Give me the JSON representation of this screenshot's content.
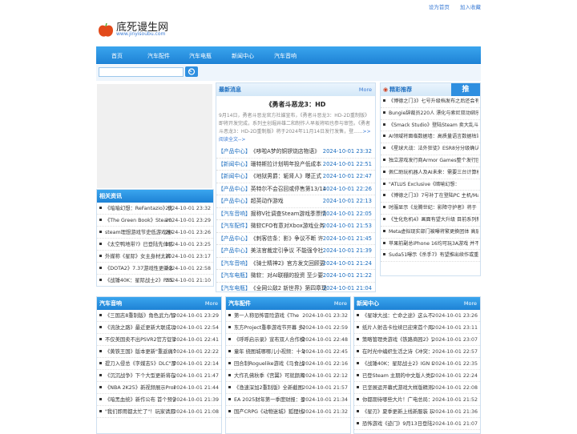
{
  "topbar": {
    "home": "设为首页",
    "fav": "加入收藏"
  },
  "logo": {
    "name": "底死谩生网",
    "url": "www.jinyisoubu.com"
  },
  "nav": [
    "首页",
    "汽车配件",
    "汽车电瓶",
    "新闻中心",
    "汽车音响"
  ],
  "colors": {
    "accent": "#1e82d5",
    "link": "#3a7bd5"
  },
  "latest": {
    "title": "最新消息",
    "more": "More",
    "headline": "《勇者斗恶龙3：HD",
    "summary": "9月14日，勇者斗恶龙官方社媒宣布，《勇者斗恶龙3：HD-2D重制版》即将开发完成，系列主创堀井雄二和制作人早坂将昭也参与审签。《勇者斗恶龙3：HD-2D重制版》将于2024年11月14日发行发售，登......",
    "read": ">>阅读全文-->",
    "items": [
      {
        "cat": "【产品中心】",
        "title": "《哆啦A梦的铜锣烧店物语》",
        "date": "2024-10-01 23:32"
      },
      {
        "cat": "【新闻中心】",
        "title": "珊特斯拉计划明年投产低成本",
        "date": "2024-10-01 22:51"
      },
      {
        "cat": "【新闻中心】",
        "title": "《地狱男爵：轭肾人》曝正式",
        "date": "2024-10-01 22:47"
      },
      {
        "cat": "【产品中心】",
        "title": "英特尔不会召回或停售第13/14",
        "date": "2024-10-01 22:26"
      },
      {
        "cat": "【产品中心】",
        "title": "超英动作游戏",
        "date": "2024-10-01 22:13"
      },
      {
        "cat": "【汽车音响】",
        "title": "掘称V社调查Steam游戏季票情",
        "date": "2024-10-01 22:05"
      },
      {
        "cat": "【汽车配件】",
        "title": "微软CFO有意对Xbox游戏业务",
        "date": "2024-10-01 21:53"
      },
      {
        "cat": "【产品中心】",
        "title": "《刺客信条：影》争议不断 许",
        "date": "2024-10-01 21:45"
      },
      {
        "cat": "【产品中心】",
        "title": "美法官裁定引争议 不能强令社",
        "date": "2024-10-01 21:39"
      },
      {
        "cat": "【汽车音响】",
        "title": "《骑士精神2》官方发文回顾更",
        "date": "2024-10-01 21:24"
      },
      {
        "cat": "【汽车电瓶】",
        "title": "微软：对AI联棚的投资 至少要",
        "date": "2024-10-01 21:22"
      },
      {
        "cat": "【汽车电瓶】",
        "title": "《全网公敌2 新世界》第四章现",
        "date": "2024-10-01 21:04"
      }
    ]
  },
  "recommend": {
    "title": "精彩推荐",
    "badge": "推",
    "items": [
      "《博德之门3》七号升级档发布之后还会有",
      "Bungie辞裁员220人 漂化与索尼双动绑乐",
      "《Smack Studio》登陆Steam 卖大乱斗风",
      "AI领域将面临数据墙：高质量语言数据枯竭",
      "《星球大战：法外狂徒》ESR8分分级确认包",
      "独立游戏发行商Armor Games整个发行团队",
      "佩仁助玩机器人及AI未来：需要三台计算机",
      "\"ATLUS Exclusive《暗喻幻想：",
      "《博德之门3》7号补丁在登陆PC 主机/Mac",
      "时服显示《龙腾世纪：影障守护者》将于",
      "《生化危机4》画面有望大升级 目前系列新",
      "Meta虚拟现实部门被曝将繁更换团体 高层",
      "苹果前副总iPhone 16均可玩3A游戏 并不",
      "Suda51曝示《杀手7》有望推出续作或重"
    ]
  },
  "related": {
    "title": "相关资讯",
    "items": [
      {
        "title": "《暗喻幻想：ReFantazio》优化",
        "date": "2024-10-01 23:32"
      },
      {
        "title": "《The Green Book》Steam页面",
        "date": "2024-10-01 23:29"
      },
      {
        "title": "steam理想游戏节史低游戏推荐",
        "date": "2024-10-01 23:26"
      },
      {
        "title": "《太空鸭地带?》已登陆先体验",
        "date": "2024-10-01 23:25"
      },
      {
        "title": "外媒称《星际》女主身材太裤",
        "date": "2024-10-01 23:17"
      },
      {
        "title": "《DOTA2》7.37游戏性更新发布",
        "date": "2024-10-01 22:58"
      },
      {
        "title": "《战锤40K：星际战士2》PS5宣",
        "date": "2024-10-01 21:10"
      }
    ]
  },
  "panels": [
    {
      "title": "汽车音响",
      "more": "More",
      "items": [
        {
          "title": "《三国志8重制版》角色武力/智力排",
          "date": "2024-10-01 23:29"
        },
        {
          "title": "《流放之路》最近更新大联成功",
          "date": "2024-10-01 22:54"
        },
        {
          "title": "不仅美国卖不出PSVR2官方促销",
          "date": "2024-10-01 22:41"
        },
        {
          "title": "《黄铁王国》版本更新\"重返痛气\"现",
          "date": "2024-10-01 22:22"
        },
        {
          "title": "提刀入侵总《字媒志5》DLC\"那马如",
          "date": "2024-10-01 22:14"
        },
        {
          "title": "《沉沉战争》下个大型更新将在2024",
          "date": "2024-10-01 21:47"
        },
        {
          "title": "《NBA 2K25》新视频展示ProPLAY",
          "date": "2024-10-01 21:44"
        },
        {
          "title": "《暗黑血统》新作公布 首个预告片",
          "date": "2024-10-01 21:39"
        },
        {
          "title": "\"我们即用都太忙了\"！玩家请愿重新",
          "date": "2024-10-01 21:08"
        }
      ]
    },
    {
      "title": "汽车配件",
      "more": "More",
      "items": [
        {
          "title": "第一人称恐怖冒险游戏《The",
          "date": "2024-10-01 23:32"
        },
        {
          "title": "东方Project重拳游戏节开幕 多款新",
          "date": "2024-10-01 22:59"
        },
        {
          "title": "《呼呼启示录》宣布双人合作模式将",
          "date": "2024-10-01 22:48"
        },
        {
          "title": "童年 绕图城哪哪儿小视频：十年后搞",
          "date": "2024-10-01 22:45"
        },
        {
          "title": "回合制Roguelike游戏《马食战藏》",
          "date": "2024-10-01 22:16"
        },
        {
          "title": "大作孔佛秋季《宫翼》可就颜离",
          "date": "2024-10-01 22:12"
        },
        {
          "title": "《渔速深加2重制版》全新截图 游戏",
          "date": "2024-10-01 21:57"
        },
        {
          "title": "EA 2025财年第一季度财报：盈利高",
          "date": "2024-10-01 21:34"
        },
        {
          "title": "国产CRPG《动物迷城》狐狸线已完",
          "date": "2024-10-01 21:32"
        }
      ]
    },
    {
      "title": "新闻中心",
      "more": "More",
      "items": [
        {
          "title": "《星球大战：亡命之途》这么不待",
          "date": "2024-10-01 23:26"
        },
        {
          "title": "纸片人射击卡拉续已迎来首个周年",
          "date": "2024-10-01 23:11"
        },
        {
          "title": "策略管理类游戏《铁路商园2》诞生",
          "date": "2024-10-01 23:07"
        },
        {
          "title": "在时光中编织生活之诗《冲突：前序",
          "date": "2024-10-01 22:57"
        },
        {
          "title": "《战锤40K：星际战士2》IGN 8分 预",
          "date": "2024-10-01 22:35"
        },
        {
          "title": "已登Steam 主期的中文版人类跳跳",
          "date": "2024-10-01 22:24"
        },
        {
          "title": "已坚展运开幕式游戏大样版精测 2008",
          "date": "2024-10-01 22:08"
        },
        {
          "title": "你都期待哪些大片！广电总局：境外",
          "date": "2024-10-01 21:52"
        },
        {
          "title": "《星刃》夏季更新上线新服装 玩家",
          "date": "2024-10-01 21:36"
        },
        {
          "title": "恐怖游戏《迹门》9月13日登陆",
          "date": "2024-10-01 21:07"
        }
      ]
    }
  ]
}
